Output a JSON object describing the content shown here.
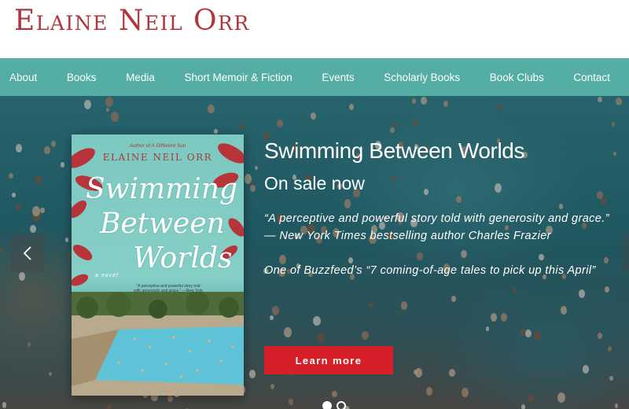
{
  "site": {
    "title": "Elaine Neil Orr"
  },
  "nav": {
    "items": [
      {
        "label": "About"
      },
      {
        "label": "Books"
      },
      {
        "label": "Media"
      },
      {
        "label": "Short Memoir & Fiction"
      },
      {
        "label": "Events"
      },
      {
        "label": "Scholarly Books"
      },
      {
        "label": "Book Clubs"
      },
      {
        "label": "Contact"
      }
    ]
  },
  "slide": {
    "cover": {
      "tagline": "Author of A Different Sun",
      "author": "ELAINE NEIL ORR",
      "title_line1": "Swimming",
      "title_line2": "Between",
      "title_line3": "Worlds",
      "novel": "a novel",
      "blurb": "\"A perceptive and powerful story told with generosity and grace.\" —New York Times bestselling author Charles Frazier"
    },
    "heading": "Swimming Between Worlds",
    "subheading": "On sale now",
    "quote": "“A perceptive and powerful story told with generosity and grace.” — New York Times bestselling author Charles Frazier",
    "note": "One of Buzzfeed’s “7 coming-of-age tales to pick up this April”",
    "button_label": "Learn more"
  },
  "carousel": {
    "prev_icon": "chevron-left-icon",
    "next_icon": "chevron-right-icon",
    "dot_count": 2,
    "active_dot": 1
  },
  "colors": {
    "brand": "#b0353c",
    "nav_bg": "#54aea3",
    "button_bg": "#d71f2a"
  }
}
